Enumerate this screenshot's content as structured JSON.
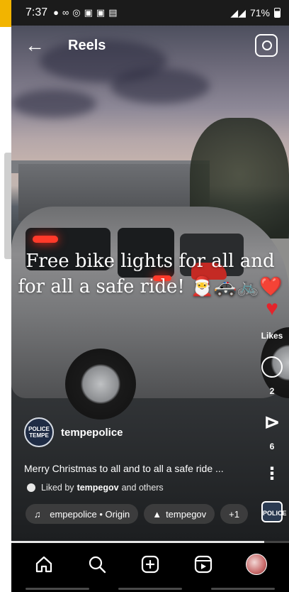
{
  "status_bar": {
    "time": "7:37",
    "notif_icons": [
      "●",
      "∞",
      "◎",
      "▣",
      "▣",
      "▤"
    ],
    "signal": "◢◢",
    "battery": "71%"
  },
  "header": {
    "back_glyph": "←",
    "title": "Reels",
    "camera_icon": "camera-icon"
  },
  "overlay_caption": {
    "line1": "Free bike lights for all and",
    "line2": "for all a safe ride! 🎅🚓🚲❤️"
  },
  "actions": {
    "likes_label": "Likes",
    "comments_count": "2",
    "shares_count": "6",
    "audio_thumb_text": "POLICE"
  },
  "post": {
    "avatar_text": "POLICE TEMPE",
    "username": "tempepolice",
    "caption": "Merry Christmas to all and to all a safe ride ...",
    "liked_by_prefix": "Liked by",
    "liked_by_user": "tempegov",
    "liked_by_suffix": "and others"
  },
  "chips": {
    "audio": " empepolice • Origin",
    "tagged": "tempegov",
    "more": "+1"
  },
  "progress": {
    "fraction": 0.91
  },
  "colors": {
    "heart": "#e3242b",
    "frame_accent": "#f2b400"
  }
}
